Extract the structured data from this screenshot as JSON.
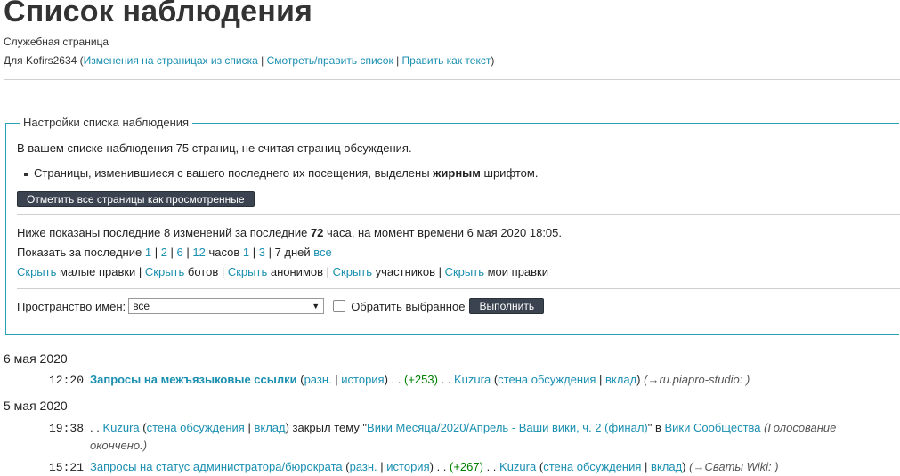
{
  "header": {
    "title": "Список наблюдения",
    "subtitle": "Служебная страница",
    "for_prefix": "Для Kofirs2634 (",
    "links": [
      "Изменения на страницах из списка",
      "Смотреть/править список",
      "Править как текст"
    ],
    "sep": " | ",
    "close": ")"
  },
  "settings": {
    "legend": "Настройки списка наблюдения",
    "count_line": "В вашем списке наблюдения 75 страниц, не считая страниц обсуждения.",
    "bullet_pre": "Страницы, изменившиеся с вашего последнего их посещения, выделены ",
    "bullet_bold": "жирным",
    "bullet_post": " шрифтом.",
    "mark_all_button": "Отметить все страницы как просмотренные",
    "shown_pre": "Ниже показаны последние 8 изменений за последние ",
    "shown_bold": "72",
    "shown_post": " часа, на момент времени 6 мая 2020 18:05.",
    "show_last_prefix": "Показать за последние ",
    "hours": [
      "1",
      "2",
      "6",
      "12"
    ],
    "hours_word": " часов ",
    "days": [
      "1",
      "3",
      "7"
    ],
    "days_word": " дней ",
    "all": "все",
    "hide_word": "Скрыть",
    "hide_items": [
      " малые правки",
      " ботов",
      " анонимов",
      " участников",
      " мои правки"
    ],
    "namespace_label": "Пространство имён:",
    "namespace_value": "все",
    "invert_label": "Обратить выбранное",
    "go_button": "Выполнить"
  },
  "changes": {
    "day1": "6 мая 2020",
    "day2": "5 мая 2020",
    "e1": {
      "time": "12:20",
      "page": "Запросы на межъязыковые ссылки",
      "diff": "разн.",
      "hist": "история",
      "size": "(+253)",
      "user": "Kuzura",
      "talk": "стена обсуждения",
      "contribs": "вклад",
      "comment": "(→ru.piapro-studio: )"
    },
    "e2": {
      "time": "19:38",
      "user": "Kuzura",
      "talk": "стена обсуждения",
      "contribs": "вклад",
      "action": " закрыл тему \"",
      "thread": "Вики Месяца/2020/Апрель - Ваши вики, ч. 2 (финал)",
      "in": "\" в ",
      "board": "Вики Сообщества",
      "comment_1": "(Голосование",
      "comment_2": "окончено.)"
    },
    "e3": {
      "time": "15:21",
      "page": "Запросы на статус администратора/бюрократа",
      "diff": "разн.",
      "hist": "история",
      "size": "(+267)",
      "user": "Kuzura",
      "talk": "стена обсуждения",
      "contribs": "вклад",
      "comment": "(→Сваты Wiki: )"
    }
  }
}
